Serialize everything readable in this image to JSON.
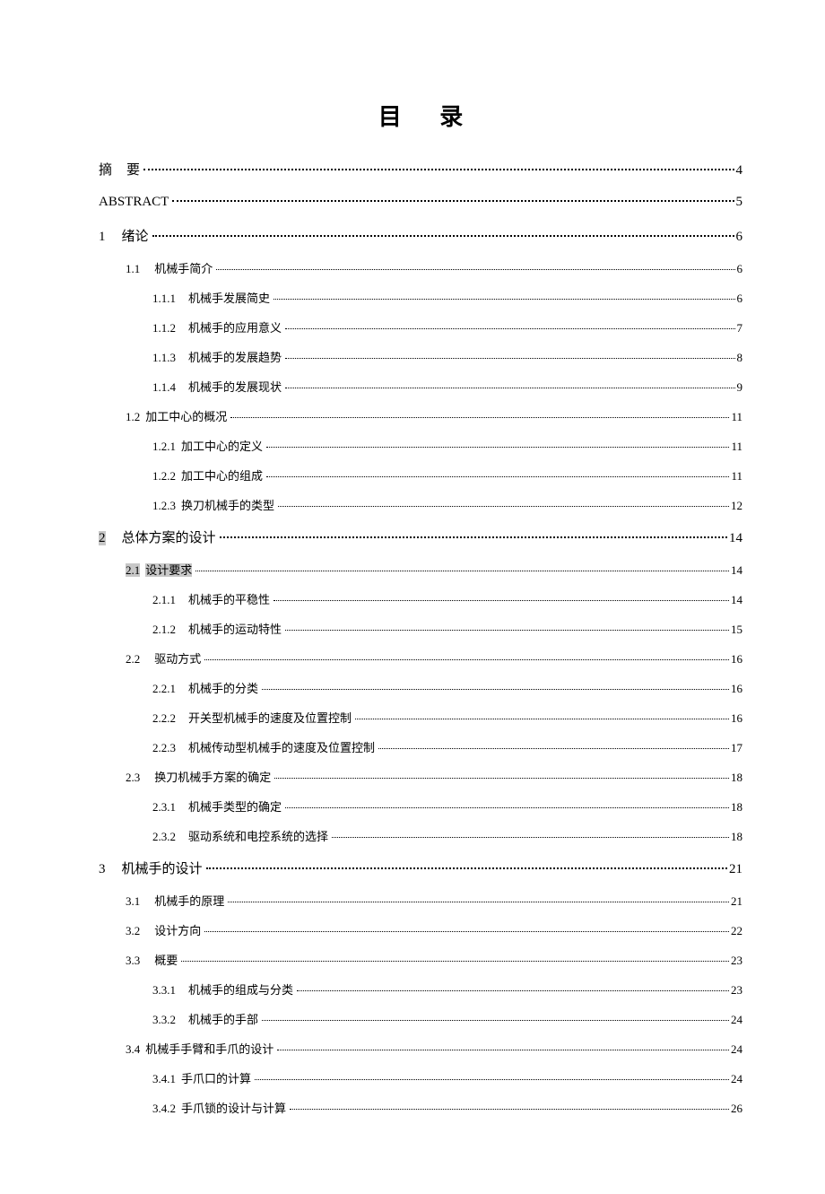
{
  "title": "目 录",
  "entries": [
    {
      "level": 0,
      "num": "摘",
      "text": "要",
      "page": "4",
      "leader": "sparse",
      "hl": false,
      "gap": 16
    },
    {
      "level": 0,
      "num": "",
      "text": "ABSTRACT",
      "page": "5",
      "leader": "sparse",
      "hl": false,
      "gap": 0
    },
    {
      "level": 0,
      "num": "1",
      "text": "绪论",
      "page": "6",
      "leader": "sparse",
      "hl": false,
      "gap": 18
    },
    {
      "level": 1,
      "num": "1.1",
      "text": "机械手简介",
      "page": "6",
      "leader": "dense",
      "hl": false,
      "gap": 16
    },
    {
      "level": 2,
      "num": "1.1.1",
      "text": "机械手发展简史",
      "page": "6",
      "leader": "dense",
      "hl": false,
      "gap": 14
    },
    {
      "level": 2,
      "num": "1.1.2",
      "text": "机械手的应用意义",
      "page": "7",
      "leader": "dense",
      "hl": false,
      "gap": 14
    },
    {
      "level": 2,
      "num": "1.1.3",
      "text": "机械手的发展趋势",
      "page": "8",
      "leader": "dense",
      "hl": false,
      "gap": 14
    },
    {
      "level": 2,
      "num": "1.1.4",
      "text": "机械手的发展现状",
      "page": "9",
      "leader": "dense",
      "hl": false,
      "gap": 14
    },
    {
      "level": 1,
      "num": "1.2",
      "text": "加工中心的概况",
      "page": "11",
      "leader": "dense",
      "hl": false,
      "gap": 6
    },
    {
      "level": 2,
      "num": "1.2.1",
      "text": "加工中心的定义",
      "page": "11",
      "leader": "dense",
      "hl": false,
      "gap": 6
    },
    {
      "level": 2,
      "num": "1.2.2",
      "text": "加工中心的组成",
      "page": "11",
      "leader": "dense",
      "hl": false,
      "gap": 6
    },
    {
      "level": 2,
      "num": "1.2.3",
      "text": "换刀机械手的类型",
      "page": "12",
      "leader": "dense",
      "hl": false,
      "gap": 6
    },
    {
      "level": 0,
      "num": "2",
      "text": "总体方案的设计",
      "page": "14",
      "leader": "sparse",
      "hl": true,
      "gap": 18
    },
    {
      "level": 1,
      "num": "2.1",
      "text": "设计要求",
      "page": "14",
      "leader": "dense",
      "hl": true,
      "gap": 6
    },
    {
      "level": 2,
      "num": "2.1.1",
      "text": "机械手的平稳性",
      "page": "14",
      "leader": "dense",
      "hl": false,
      "gap": 14
    },
    {
      "level": 2,
      "num": "2.1.2",
      "text": "机械手的运动特性",
      "page": "15",
      "leader": "dense",
      "hl": false,
      "gap": 14
    },
    {
      "level": 1,
      "num": "2.2",
      "text": "驱动方式",
      "page": "16",
      "leader": "dense",
      "hl": false,
      "gap": 16
    },
    {
      "level": 2,
      "num": "2.2.1",
      "text": "机械手的分类",
      "page": "16",
      "leader": "dense",
      "hl": false,
      "gap": 14
    },
    {
      "level": 2,
      "num": "2.2.2",
      "text": "开关型机械手的速度及位置控制",
      "page": "16",
      "leader": "dense",
      "hl": false,
      "gap": 14
    },
    {
      "level": 2,
      "num": "2.2.3",
      "text": "机械传动型机械手的速度及位置控制",
      "page": "17",
      "leader": "dense",
      "hl": false,
      "gap": 14
    },
    {
      "level": 1,
      "num": "2.3",
      "text": "换刀机械手方案的确定",
      "page": "18",
      "leader": "dense",
      "hl": false,
      "gap": 16
    },
    {
      "level": 2,
      "num": "2.3.1",
      "text": "机械手类型的确定",
      "page": "18",
      "leader": "dense",
      "hl": false,
      "gap": 14
    },
    {
      "level": 2,
      "num": "2.3.2",
      "text": "驱动系统和电控系统的选择",
      "page": "18",
      "leader": "dense",
      "hl": false,
      "gap": 14
    },
    {
      "level": 0,
      "num": "3",
      "text": "机械手的设计",
      "page": "21",
      "leader": "sparse",
      "hl": false,
      "gap": 18
    },
    {
      "level": 1,
      "num": "3.1",
      "text": "机械手的原理",
      "page": "21",
      "leader": "dense",
      "hl": false,
      "gap": 16
    },
    {
      "level": 1,
      "num": "3.2",
      "text": "设计方向",
      "page": "22",
      "leader": "dense",
      "hl": false,
      "gap": 16
    },
    {
      "level": 1,
      "num": "3.3",
      "text": "概要",
      "page": "23",
      "leader": "dense",
      "hl": false,
      "gap": 16
    },
    {
      "level": 2,
      "num": "3.3.1",
      "text": "机械手的组成与分类",
      "page": "23",
      "leader": "dense",
      "hl": false,
      "gap": 14
    },
    {
      "level": 2,
      "num": "3.3.2",
      "text": "机械手的手部",
      "page": "24",
      "leader": "dense",
      "hl": false,
      "gap": 14
    },
    {
      "level": 1,
      "num": "3.4",
      "text": "机械手手臂和手爪的设计",
      "page": "24",
      "leader": "dense",
      "hl": false,
      "gap": 6
    },
    {
      "level": 2,
      "num": "3.4.1",
      "text": "手爪口的计算",
      "page": "24",
      "leader": "dense",
      "hl": false,
      "gap": 6
    },
    {
      "level": 2,
      "num": "3.4.2",
      "text": "手爪锁的设计与计算",
      "page": "26",
      "leader": "dense",
      "hl": false,
      "gap": 6
    }
  ]
}
